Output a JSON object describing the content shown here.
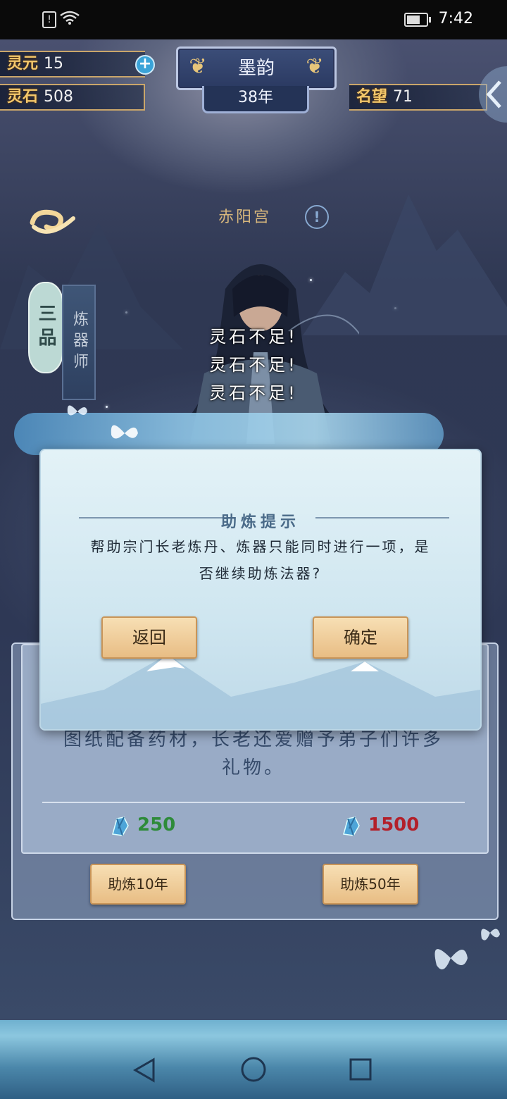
{
  "status_bar": {
    "time": "7:42"
  },
  "resources": {
    "lingyuan_label": "灵元",
    "lingyuan_value": "15",
    "lingshi_label": "灵石",
    "lingshi_value": "508",
    "mingwang_label": "名望",
    "mingwang_value": "71"
  },
  "header": {
    "name": "墨韵",
    "year": "38年"
  },
  "sect": {
    "name": "赤阳宫"
  },
  "rank": {
    "grade": "三品",
    "title": "炼器师"
  },
  "warnings": [
    "灵石不足!",
    "灵石不足!",
    "灵石不足!"
  ],
  "background_panel": {
    "desc_line1": "图纸配备药材，长老还爱赠予弟子们许多",
    "desc_line2": "礼物。",
    "cost_10": "250",
    "cost_50": "1500",
    "btn_10": "助炼10年",
    "btn_50": "助炼50年",
    "cost_10_color": "#2e8b3a",
    "cost_50_color": "#b3202a"
  },
  "dialog": {
    "title": "助炼提示",
    "message": "帮助宗门长老炼丹、炼器只能同时进行一项，是否继续助炼法器?",
    "back_label": "返回",
    "confirm_label": "确定"
  }
}
